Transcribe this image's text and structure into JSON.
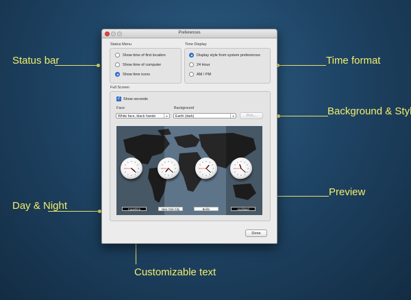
{
  "callouts": {
    "status_bar": "Status bar",
    "time_format": "Time format",
    "background_style": "Background & Style",
    "preview": "Preview",
    "day_night": "Day & Night",
    "customizable_text": "Customizable text"
  },
  "window": {
    "title": "Preferences"
  },
  "status_menu": {
    "label": "Status Menu",
    "options": [
      "Show time of first location",
      "Show time of computer",
      "Show time icons"
    ],
    "selected_index": 2
  },
  "time_display": {
    "label": "Time Display",
    "options": [
      "Display style from system preferences",
      "24 Hour",
      "AM / PM"
    ],
    "selected_index": 0
  },
  "full_screen": {
    "label": "Full Screen",
    "show_seconds_label": "Show seconds",
    "show_seconds_checked": true,
    "face_label": "Face",
    "face_value": "White face, black hands",
    "background_label": "Background",
    "background_value": "Earth (dark)",
    "pick_label": "Pick..."
  },
  "clocks": [
    {
      "city": "Cupertino",
      "hour": 4,
      "minute": 22,
      "second": 45,
      "night": true
    },
    {
      "city": "New York City",
      "hour": 7,
      "minute": 22,
      "second": 45,
      "night": false
    },
    {
      "city": "Berlin",
      "hour": 1,
      "minute": 22,
      "second": 45,
      "night": false
    },
    {
      "city": "Auckland",
      "hour": 11,
      "minute": 22,
      "second": 45,
      "night": true
    }
  ],
  "done_label": "Done",
  "colors": {
    "callout": "#f4ee6b",
    "accent": "#3b7ddd"
  }
}
